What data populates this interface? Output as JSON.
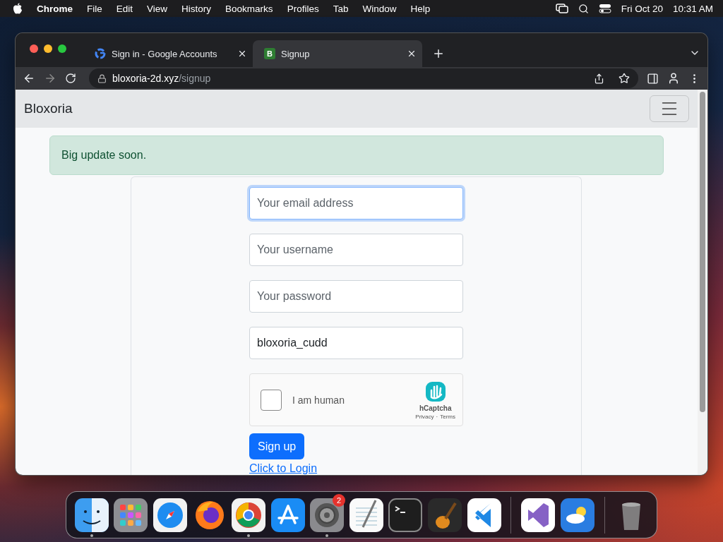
{
  "menubar": {
    "app": "Chrome",
    "menus": [
      "File",
      "Edit",
      "View",
      "History",
      "Bookmarks",
      "Profiles",
      "Tab",
      "Window",
      "Help"
    ],
    "date": "Fri Oct 20",
    "time": "10:31 AM"
  },
  "browser": {
    "tabs": [
      {
        "kind": "google",
        "title": "Sign in - Google Accounts",
        "selected": false
      },
      {
        "kind": "letter",
        "letter": "B",
        "title": "Signup",
        "selected": true
      }
    ],
    "url": {
      "host": "bloxoria-2d.xyz",
      "path": "/signup"
    }
  },
  "page": {
    "brand": "Bloxoria",
    "alert": "Big update soon.",
    "fields": [
      {
        "placeholder": "Your email address",
        "focused": true
      },
      {
        "placeholder": "Your username",
        "focused": false
      },
      {
        "placeholder": "Your password",
        "focused": false
      },
      {
        "value": "bloxoria_cudd",
        "focused": false
      }
    ],
    "captcha": {
      "label": "I am human",
      "checked": false,
      "brand": "hCaptcha",
      "privacy": "Privacy",
      "separator": "·",
      "terms": "Terms"
    },
    "submit": "Sign up",
    "login_link": "Click to Login"
  },
  "dock": {
    "groups": [
      [
        {
          "kind": "finder",
          "running": true
        },
        {
          "kind": "launchpad",
          "running": false
        },
        {
          "kind": "safari",
          "running": false
        },
        {
          "kind": "firefox",
          "running": false
        },
        {
          "kind": "chrome",
          "running": true
        },
        {
          "kind": "appstore",
          "running": false
        },
        {
          "kind": "settings",
          "running": true,
          "badge": "2"
        },
        {
          "kind": "textedit",
          "running": false
        },
        {
          "kind": "terminal",
          "running": false
        },
        {
          "kind": "garageband",
          "running": false
        },
        {
          "kind": "vscode",
          "running": false
        }
      ],
      [
        {
          "kind": "visualstudio",
          "running": false
        },
        {
          "kind": "weather",
          "running": false
        }
      ],
      [
        {
          "kind": "trash",
          "running": false
        }
      ]
    ]
  }
}
